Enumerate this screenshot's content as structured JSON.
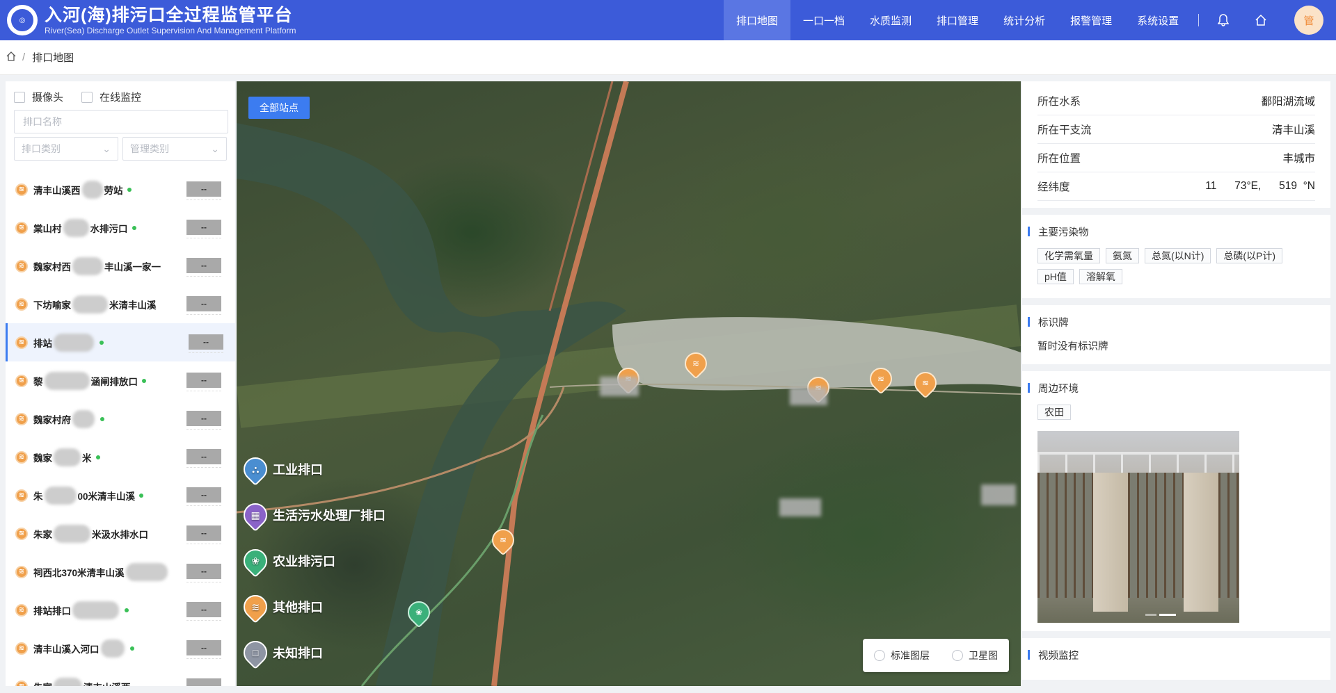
{
  "header": {
    "title": "入河(海)排污口全过程监管平台",
    "subtitle": "River(Sea) Discharge Outlet Supervision And Management Platform",
    "nav": [
      "排口地图",
      "一口一档",
      "水质监测",
      "排口管理",
      "统计分析",
      "报警管理",
      "系统设置"
    ],
    "avatar_text": "管"
  },
  "breadcrumb": {
    "current": "排口地图"
  },
  "left_panel": {
    "checkboxes": [
      "摄像头",
      "在线监控"
    ],
    "search_placeholder": "排口名称",
    "select_type_placeholder": "排口类别",
    "select_manage_placeholder": "管理类别",
    "badge_text": "--",
    "items": [
      "清丰山溪西",
      "棠山村",
      "魏家村西",
      "下坊喻家",
      "排站",
      "黎",
      "魏家村府",
      "魏家",
      "朱",
      "朱家",
      "祠西北370米清丰山溪",
      "排站排口",
      "清丰山溪入河口",
      "朱家"
    ],
    "items_suffix": [
      "劳站",
      "水排污口",
      "丰山溪一家一",
      "米清丰山溪",
      "",
      "涵闸排放口",
      "",
      "米",
      "00米清丰山溪",
      "米汲水排水口",
      "",
      "",
      "",
      "清丰山溪西"
    ]
  },
  "map": {
    "all_stations_label": "全部站点",
    "legend": [
      {
        "label": "工业排口",
        "color": "#4a8ed1",
        "icon": "factory-icon",
        "glyph": "⛬"
      },
      {
        "label": "生活污水处理厂排口",
        "color": "#8a63c8",
        "icon": "building-icon",
        "glyph": "▦"
      },
      {
        "label": "农业排污口",
        "color": "#3ab07a",
        "icon": "plant-icon",
        "glyph": "❀"
      },
      {
        "label": "其他排口",
        "color": "#f0a04b",
        "icon": "outlet-icon",
        "glyph": "≋"
      },
      {
        "label": "未知排口",
        "color": "#8e95a3",
        "icon": "unknown-icon",
        "glyph": "□"
      }
    ],
    "layers": [
      "标准图层",
      "卫星图"
    ]
  },
  "right_panel": {
    "info": [
      {
        "label": "所在水系",
        "value": "鄱阳湖流域"
      },
      {
        "label": "所在干支流",
        "value": "清丰山溪"
      },
      {
        "label": "所在位置",
        "value": "丰城市"
      },
      {
        "label": "经纬度",
        "value": "11      73°E,      519  °N"
      }
    ],
    "pollutants_title": "主要污染物",
    "pollutants": [
      "化学需氧量",
      "氨氮",
      "总氮(以N计)",
      "总磷(以P计)",
      "pH值",
      "溶解氧"
    ],
    "sign_title": "标识牌",
    "sign_text": "暂时没有标识牌",
    "env_title": "周边环境",
    "env_tag": "农田",
    "video_title": "视频监控"
  },
  "colors": {
    "header": "#3c5bd9",
    "accent": "#3c7cf0",
    "marker": "#f0a04b",
    "online": "#3ac057"
  }
}
